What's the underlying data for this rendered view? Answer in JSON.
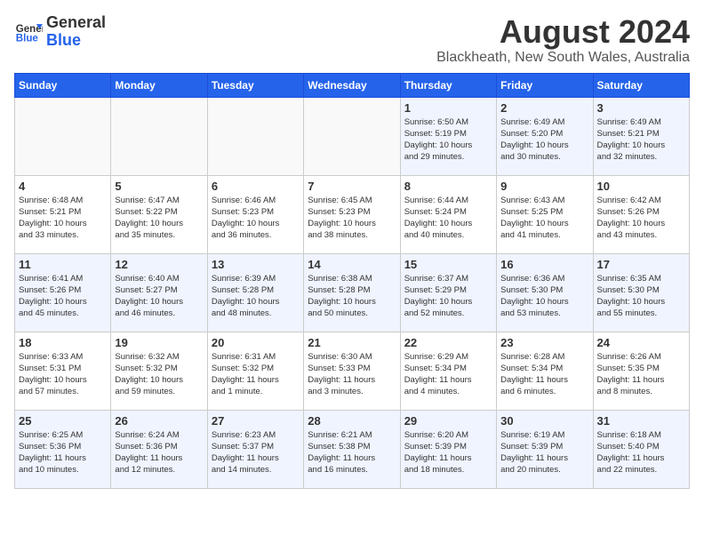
{
  "header": {
    "logo_general": "General",
    "logo_blue": "Blue",
    "cal_title": "August 2024",
    "cal_subtitle": "Blackheath, New South Wales, Australia"
  },
  "days_of_week": [
    "Sunday",
    "Monday",
    "Tuesday",
    "Wednesday",
    "Thursday",
    "Friday",
    "Saturday"
  ],
  "weeks": [
    [
      {
        "day": "",
        "info": ""
      },
      {
        "day": "",
        "info": ""
      },
      {
        "day": "",
        "info": ""
      },
      {
        "day": "",
        "info": ""
      },
      {
        "day": "1",
        "info": "Sunrise: 6:50 AM\nSunset: 5:19 PM\nDaylight: 10 hours\nand 29 minutes."
      },
      {
        "day": "2",
        "info": "Sunrise: 6:49 AM\nSunset: 5:20 PM\nDaylight: 10 hours\nand 30 minutes."
      },
      {
        "day": "3",
        "info": "Sunrise: 6:49 AM\nSunset: 5:21 PM\nDaylight: 10 hours\nand 32 minutes."
      }
    ],
    [
      {
        "day": "4",
        "info": "Sunrise: 6:48 AM\nSunset: 5:21 PM\nDaylight: 10 hours\nand 33 minutes."
      },
      {
        "day": "5",
        "info": "Sunrise: 6:47 AM\nSunset: 5:22 PM\nDaylight: 10 hours\nand 35 minutes."
      },
      {
        "day": "6",
        "info": "Sunrise: 6:46 AM\nSunset: 5:23 PM\nDaylight: 10 hours\nand 36 minutes."
      },
      {
        "day": "7",
        "info": "Sunrise: 6:45 AM\nSunset: 5:23 PM\nDaylight: 10 hours\nand 38 minutes."
      },
      {
        "day": "8",
        "info": "Sunrise: 6:44 AM\nSunset: 5:24 PM\nDaylight: 10 hours\nand 40 minutes."
      },
      {
        "day": "9",
        "info": "Sunrise: 6:43 AM\nSunset: 5:25 PM\nDaylight: 10 hours\nand 41 minutes."
      },
      {
        "day": "10",
        "info": "Sunrise: 6:42 AM\nSunset: 5:26 PM\nDaylight: 10 hours\nand 43 minutes."
      }
    ],
    [
      {
        "day": "11",
        "info": "Sunrise: 6:41 AM\nSunset: 5:26 PM\nDaylight: 10 hours\nand 45 minutes."
      },
      {
        "day": "12",
        "info": "Sunrise: 6:40 AM\nSunset: 5:27 PM\nDaylight: 10 hours\nand 46 minutes."
      },
      {
        "day": "13",
        "info": "Sunrise: 6:39 AM\nSunset: 5:28 PM\nDaylight: 10 hours\nand 48 minutes."
      },
      {
        "day": "14",
        "info": "Sunrise: 6:38 AM\nSunset: 5:28 PM\nDaylight: 10 hours\nand 50 minutes."
      },
      {
        "day": "15",
        "info": "Sunrise: 6:37 AM\nSunset: 5:29 PM\nDaylight: 10 hours\nand 52 minutes."
      },
      {
        "day": "16",
        "info": "Sunrise: 6:36 AM\nSunset: 5:30 PM\nDaylight: 10 hours\nand 53 minutes."
      },
      {
        "day": "17",
        "info": "Sunrise: 6:35 AM\nSunset: 5:30 PM\nDaylight: 10 hours\nand 55 minutes."
      }
    ],
    [
      {
        "day": "18",
        "info": "Sunrise: 6:33 AM\nSunset: 5:31 PM\nDaylight: 10 hours\nand 57 minutes."
      },
      {
        "day": "19",
        "info": "Sunrise: 6:32 AM\nSunset: 5:32 PM\nDaylight: 10 hours\nand 59 minutes."
      },
      {
        "day": "20",
        "info": "Sunrise: 6:31 AM\nSunset: 5:32 PM\nDaylight: 11 hours\nand 1 minute."
      },
      {
        "day": "21",
        "info": "Sunrise: 6:30 AM\nSunset: 5:33 PM\nDaylight: 11 hours\nand 3 minutes."
      },
      {
        "day": "22",
        "info": "Sunrise: 6:29 AM\nSunset: 5:34 PM\nDaylight: 11 hours\nand 4 minutes."
      },
      {
        "day": "23",
        "info": "Sunrise: 6:28 AM\nSunset: 5:34 PM\nDaylight: 11 hours\nand 6 minutes."
      },
      {
        "day": "24",
        "info": "Sunrise: 6:26 AM\nSunset: 5:35 PM\nDaylight: 11 hours\nand 8 minutes."
      }
    ],
    [
      {
        "day": "25",
        "info": "Sunrise: 6:25 AM\nSunset: 5:36 PM\nDaylight: 11 hours\nand 10 minutes."
      },
      {
        "day": "26",
        "info": "Sunrise: 6:24 AM\nSunset: 5:36 PM\nDaylight: 11 hours\nand 12 minutes."
      },
      {
        "day": "27",
        "info": "Sunrise: 6:23 AM\nSunset: 5:37 PM\nDaylight: 11 hours\nand 14 minutes."
      },
      {
        "day": "28",
        "info": "Sunrise: 6:21 AM\nSunset: 5:38 PM\nDaylight: 11 hours\nand 16 minutes."
      },
      {
        "day": "29",
        "info": "Sunrise: 6:20 AM\nSunset: 5:39 PM\nDaylight: 11 hours\nand 18 minutes."
      },
      {
        "day": "30",
        "info": "Sunrise: 6:19 AM\nSunset: 5:39 PM\nDaylight: 11 hours\nand 20 minutes."
      },
      {
        "day": "31",
        "info": "Sunrise: 6:18 AM\nSunset: 5:40 PM\nDaylight: 11 hours\nand 22 minutes."
      }
    ]
  ]
}
